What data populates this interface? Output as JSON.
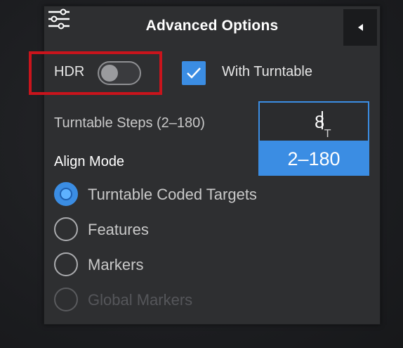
{
  "panel": {
    "title": "Advanced Options",
    "menu_icon": "sliders-icon",
    "collapse_icon": "arrow-left-icon"
  },
  "hdr": {
    "label": "HDR",
    "enabled": false,
    "highlight_color": "#c9141c"
  },
  "turntable": {
    "label": "With Turntable",
    "checked": true
  },
  "steps": {
    "label": "Turntable Steps (2–180)",
    "value": "8",
    "range_hint": "2–180"
  },
  "align_mode": {
    "label": "Align Mode",
    "options": [
      {
        "label": "Turntable Coded Targets",
        "selected": true,
        "disabled": false
      },
      {
        "label": "Features",
        "selected": false,
        "disabled": false
      },
      {
        "label": "Markers",
        "selected": false,
        "disabled": false
      },
      {
        "label": "Global Markers",
        "selected": false,
        "disabled": true
      }
    ]
  },
  "colors": {
    "accent": "#3b8de3",
    "panel_bg": "#2e2f31"
  }
}
